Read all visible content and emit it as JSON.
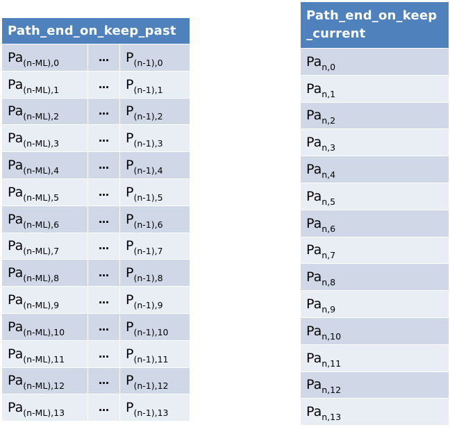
{
  "past_table": {
    "header": "Path_end_on_keep_past",
    "ellipsis": "…",
    "rows": [
      {
        "left_base": "Pa",
        "left_sub": "(n-ML),0",
        "right_base": "P",
        "right_sub": "(n-1),0"
      },
      {
        "left_base": "Pa",
        "left_sub": "(n-ML),1",
        "right_base": "P",
        "right_sub": "(n-1),1"
      },
      {
        "left_base": "Pa",
        "left_sub": "(n-ML),2",
        "right_base": "P",
        "right_sub": "(n-1),2"
      },
      {
        "left_base": "Pa",
        "left_sub": "(n-ML),3",
        "right_base": "P",
        "right_sub": "(n-1),3"
      },
      {
        "left_base": "Pa",
        "left_sub": "(n-ML),4",
        "right_base": "P",
        "right_sub": "(n-1),4"
      },
      {
        "left_base": "Pa",
        "left_sub": "(n-ML),5",
        "right_base": "P",
        "right_sub": "(n-1),5"
      },
      {
        "left_base": "Pa",
        "left_sub": "(n-ML),6",
        "right_base": "P",
        "right_sub": "(n-1),6"
      },
      {
        "left_base": "Pa",
        "left_sub": "(n-ML),7",
        "right_base": "P",
        "right_sub": "(n-1),7"
      },
      {
        "left_base": "Pa",
        "left_sub": "(n-ML),8",
        "right_base": "P",
        "right_sub": "(n-1),8"
      },
      {
        "left_base": "Pa",
        "left_sub": "(n-ML),9",
        "right_base": "P",
        "right_sub": "(n-1),9"
      },
      {
        "left_base": "Pa",
        "left_sub": "(n-ML),10",
        "right_base": "P",
        "right_sub": "(n-1),10"
      },
      {
        "left_base": "Pa",
        "left_sub": "(n-ML),11",
        "right_base": "P",
        "right_sub": "(n-1),11"
      },
      {
        "left_base": "Pa",
        "left_sub": "(n-ML),12",
        "right_base": "P",
        "right_sub": "(n-1),12"
      },
      {
        "left_base": "Pa",
        "left_sub": "(n-ML),13",
        "right_base": "P",
        "right_sub": "(n-1),13"
      }
    ]
  },
  "current_table": {
    "header_line1": "Path_end_on_keep",
    "header_line2": "_current",
    "rows": [
      {
        "base": "Pa",
        "sub": "n,0"
      },
      {
        "base": "Pa",
        "sub": "n,1"
      },
      {
        "base": "Pa",
        "sub": "n,2"
      },
      {
        "base": "Pa",
        "sub": "n,3"
      },
      {
        "base": "Pa",
        "sub": "n,4"
      },
      {
        "base": "Pa",
        "sub": "n,5"
      },
      {
        "base": "Pa",
        "sub": "n,6"
      },
      {
        "base": "Pa",
        "sub": "n,7"
      },
      {
        "base": "Pa",
        "sub": "n,8"
      },
      {
        "base": "Pa",
        "sub": "n,9"
      },
      {
        "base": "Pa",
        "sub": "n,10"
      },
      {
        "base": "Pa",
        "sub": "n,11"
      },
      {
        "base": "Pa",
        "sub": "n,12"
      },
      {
        "base": "Pa",
        "sub": "n,13"
      }
    ]
  },
  "colors": {
    "header_bg": "#4f81bd",
    "row_dark": "#d0d8e8",
    "row_light": "#e9edf4"
  }
}
